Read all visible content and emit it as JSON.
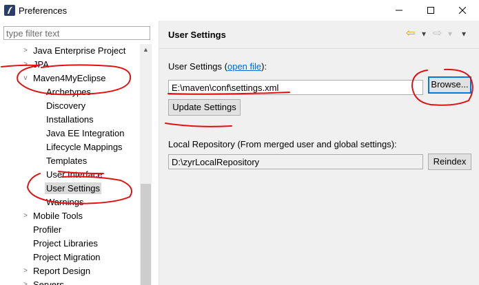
{
  "window": {
    "title": "Preferences",
    "minimize_glyph": "—",
    "maximize_glyph": "☐",
    "close_glyph": "✕"
  },
  "filter": {
    "placeholder": "type filter text"
  },
  "tree": {
    "items": [
      {
        "label": "Java Enterprise Project",
        "arrow": ">"
      },
      {
        "label": "JPA",
        "arrow": ">"
      },
      {
        "label": "Maven4MyEclipse",
        "arrow": "v"
      },
      {
        "label": "Archetypes"
      },
      {
        "label": "Discovery"
      },
      {
        "label": "Installations"
      },
      {
        "label": "Java EE Integration"
      },
      {
        "label": "Lifecycle Mappings"
      },
      {
        "label": "Templates"
      },
      {
        "label": "User Interface"
      },
      {
        "label": "User Settings"
      },
      {
        "label": "Warnings"
      },
      {
        "label": "Mobile Tools",
        "arrow": ">"
      },
      {
        "label": "Profiler"
      },
      {
        "label": "Project Libraries"
      },
      {
        "label": "Project Migration"
      },
      {
        "label": "Report Design",
        "arrow": ">"
      },
      {
        "label": "Servers",
        "arrow": ">"
      }
    ],
    "scroll_up_glyph": "▲"
  },
  "page": {
    "title": "User Settings",
    "nav": {
      "back_glyph": "⇦",
      "forward_glyph": "⇨",
      "dropdown_glyph": "▾",
      "menu_glyph": "▾"
    },
    "user_settings_label_prefix": "User Settings (",
    "open_file_link": "open file",
    "user_settings_label_suffix": "):",
    "settings_path": "E:\\maven\\conf\\settings.xml",
    "browse_button": "Browse...",
    "update_button": "Update Settings",
    "local_repo_label": "Local Repository (From merged user and global settings):",
    "local_repo_path": "D:\\zyrLocalRepository",
    "reindex_button": "Reindex"
  },
  "colors": {
    "annotation_ink": "#e01010",
    "link": "#0066cc",
    "default_button_border": "#0078d7",
    "selection": "#d9d9d9"
  },
  "icons": {
    "app": "eclipse-icon"
  }
}
